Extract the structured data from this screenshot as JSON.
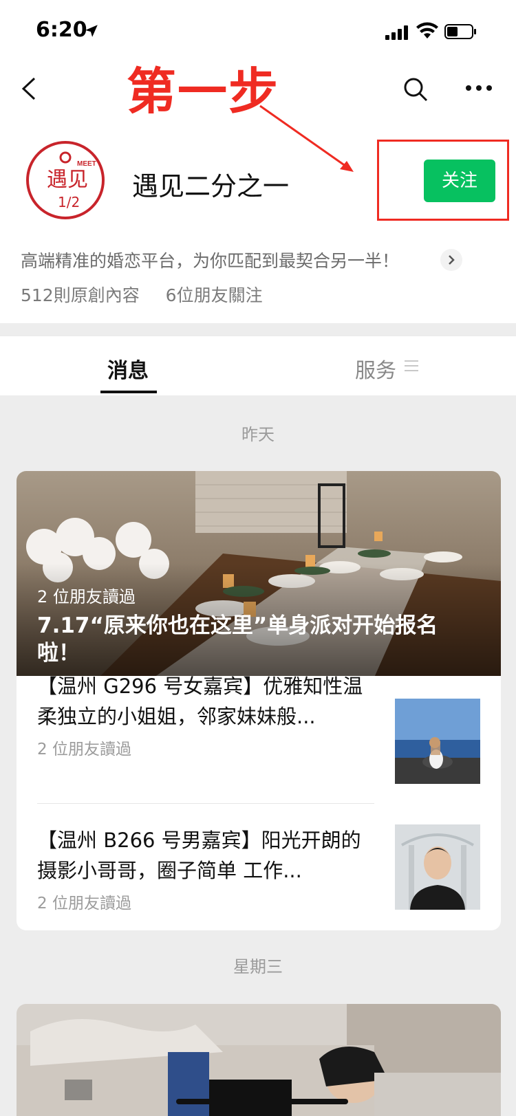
{
  "status": {
    "time": "6:20"
  },
  "annotation": {
    "text": "第一步"
  },
  "account": {
    "name": "遇见二分之一",
    "logo_text_top": "MEET",
    "logo_text_main": "遇见",
    "logo_text_fraction": "1/2",
    "follow_label": "关注",
    "description": "高端精准的婚恋平台，为你匹配到最契合另一半！",
    "stats": [
      "512則原創內容",
      "6位朋友關注"
    ]
  },
  "tabs": [
    {
      "label": "消息",
      "active": true
    },
    {
      "label": "服务",
      "active": false
    }
  ],
  "feed": {
    "groups": [
      {
        "date": "昨天",
        "hero": {
          "readers": "2 位朋友讀過",
          "title": "7.17“原来你也在这里”单身派对开始报名啦！"
        },
        "articles": [
          {
            "title": "【温州 G296 号女嘉宾】优雅知性温柔独立的小姐姐，邻家妹妹般...",
            "readers": "2 位朋友讀過"
          },
          {
            "title": "【温州 B266 号男嘉宾】阳光开朗的摄影小哥哥，圈子简单 工作...",
            "readers": "2 位朋友讀過"
          }
        ]
      },
      {
        "date": "星期三"
      }
    ]
  },
  "colors": {
    "accent_green": "#07c160",
    "annotation_red": "#ef2b22",
    "logo_red": "#c8242b"
  }
}
